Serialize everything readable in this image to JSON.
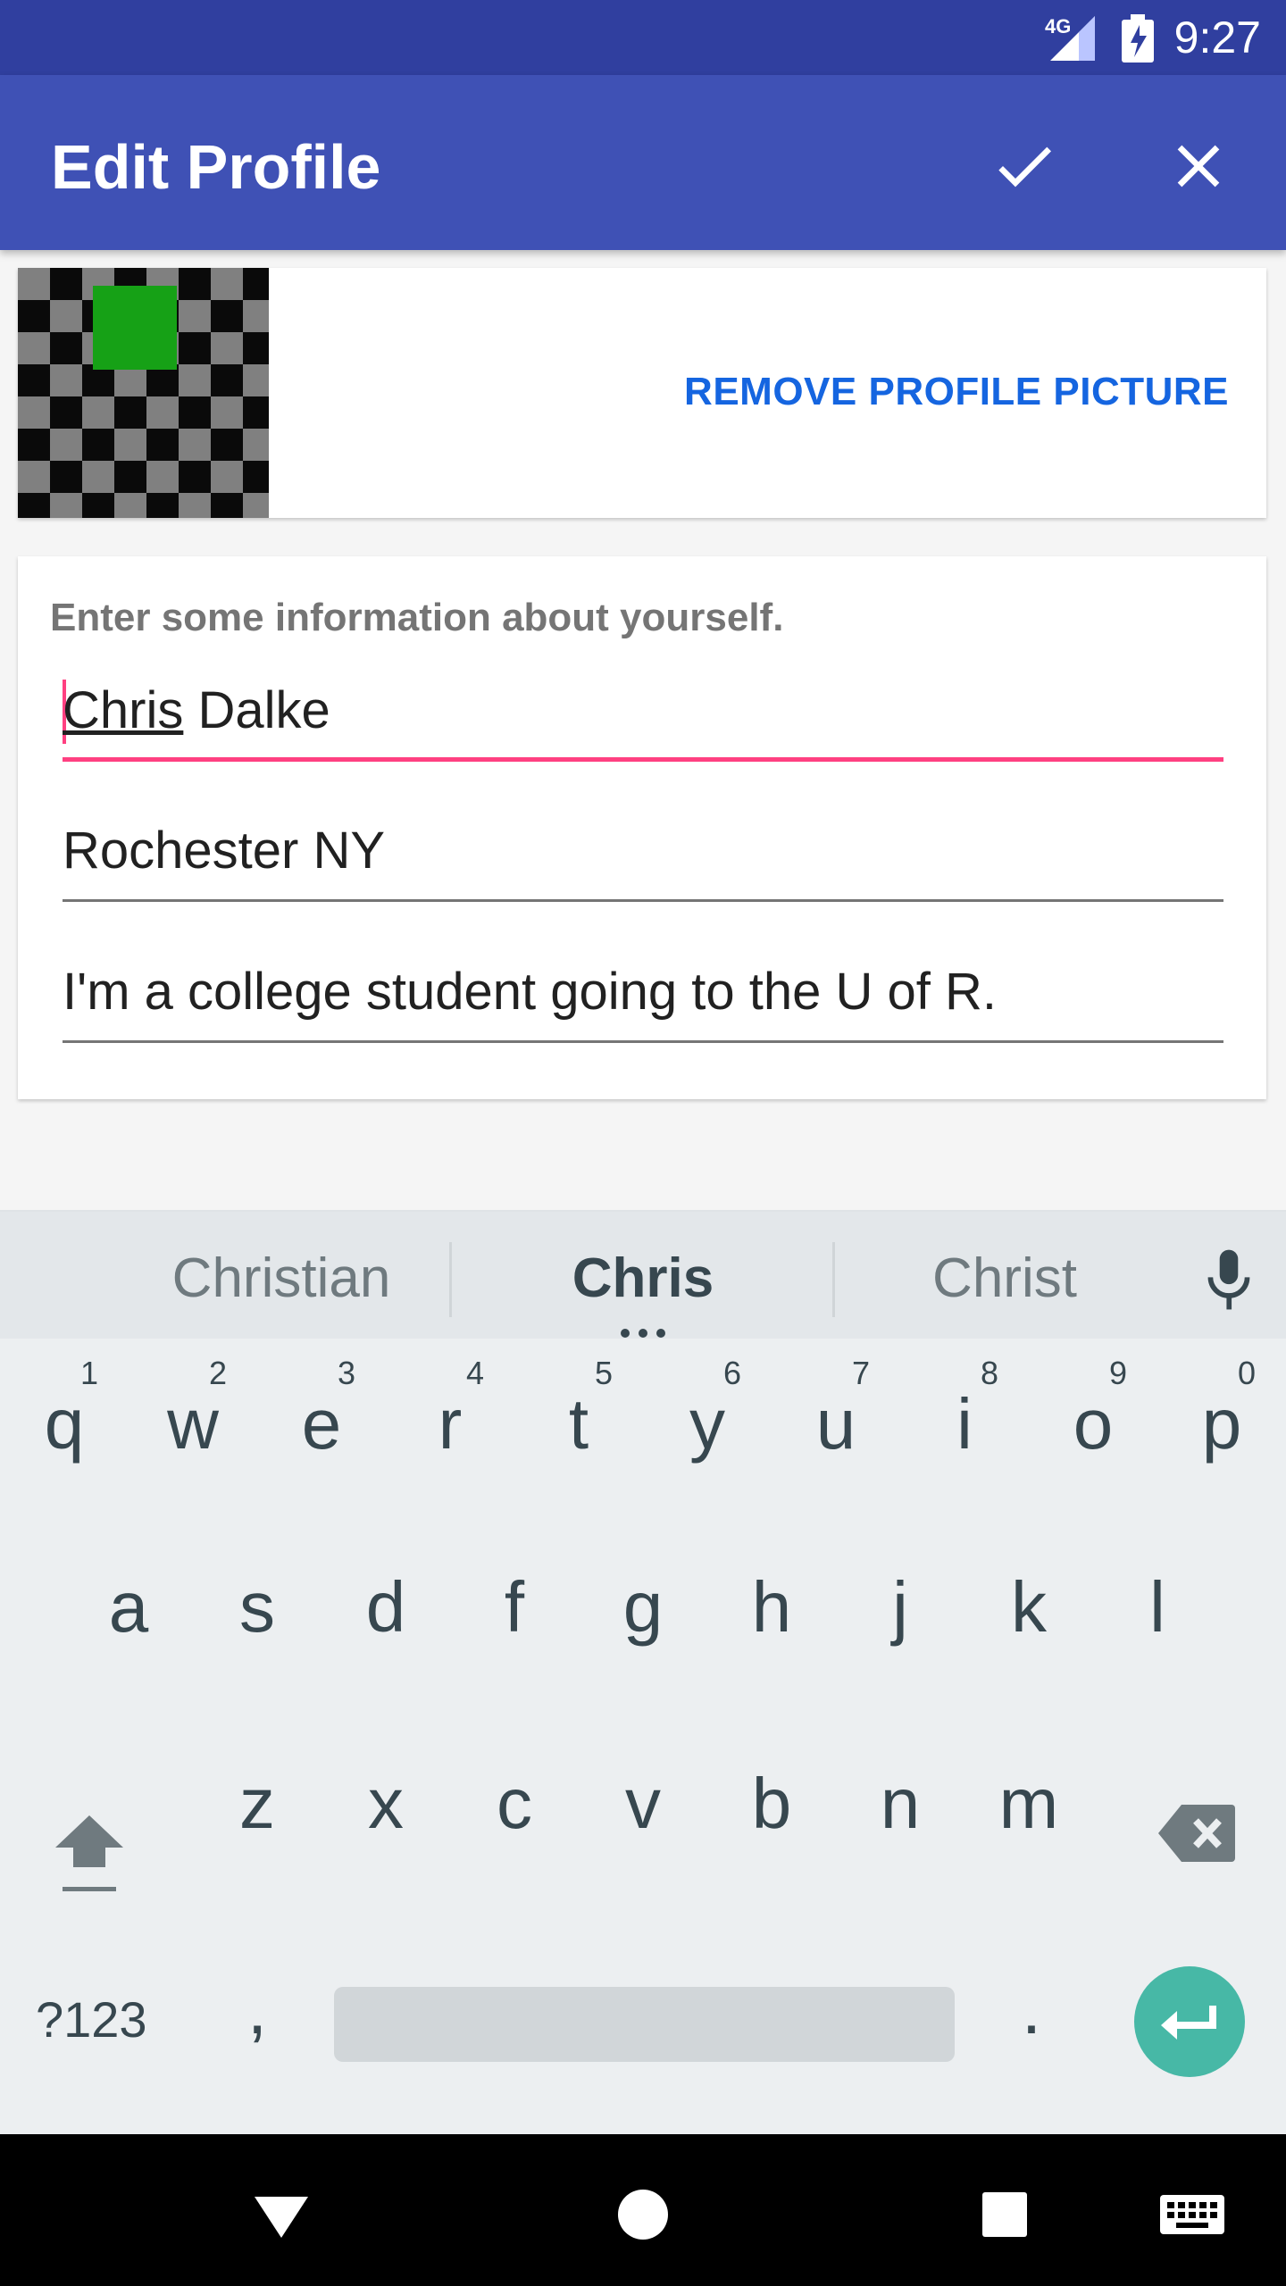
{
  "status_bar": {
    "time": "9:27",
    "network": "4G"
  },
  "app_bar": {
    "title": "Edit Profile",
    "confirm_icon": "check-icon",
    "close_icon": "close-icon"
  },
  "profile_photo": {
    "remove_label": "REMOVE PROFILE PICTURE"
  },
  "info": {
    "hint": "Enter some information about yourself.",
    "name_composing": "Chris",
    "name_rest": " Dalke",
    "location": "Rochester NY",
    "bio": "I'm a college student going to the U of R."
  },
  "keyboard": {
    "suggestions": [
      "Christian",
      "Chris",
      "Christ"
    ],
    "row1": [
      {
        "l": "q",
        "n": "1"
      },
      {
        "l": "w",
        "n": "2"
      },
      {
        "l": "e",
        "n": "3"
      },
      {
        "l": "r",
        "n": "4"
      },
      {
        "l": "t",
        "n": "5"
      },
      {
        "l": "y",
        "n": "6"
      },
      {
        "l": "u",
        "n": "7"
      },
      {
        "l": "i",
        "n": "8"
      },
      {
        "l": "o",
        "n": "9"
      },
      {
        "l": "p",
        "n": "0"
      }
    ],
    "row2": [
      "a",
      "s",
      "d",
      "f",
      "g",
      "h",
      "j",
      "k",
      "l"
    ],
    "row3": [
      "z",
      "x",
      "c",
      "v",
      "b",
      "n",
      "m"
    ],
    "symbols_label": "?123",
    "comma": ",",
    "period": "."
  },
  "colors": {
    "primary": "#3f51b5",
    "primary_dark": "#303f9f",
    "accent": "#ff4081",
    "link": "#1565e0",
    "enter": "#47b8a6"
  }
}
